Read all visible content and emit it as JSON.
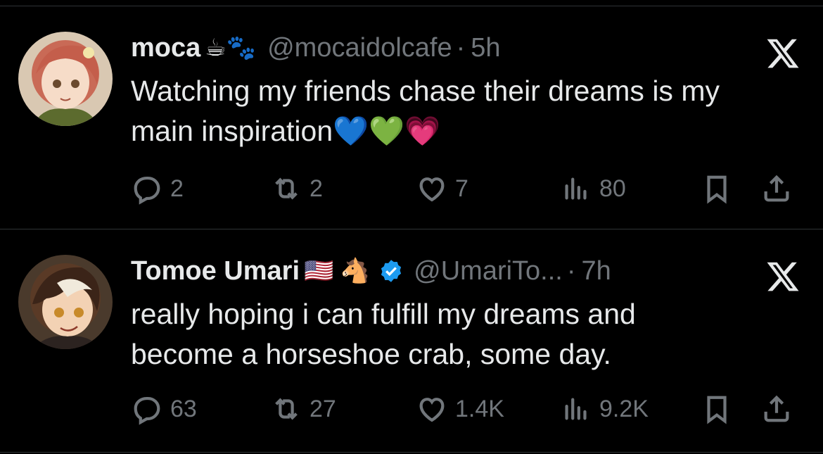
{
  "tweets": [
    {
      "name": "moca",
      "name_emoji": "☕🐾",
      "handle": "@mocaidolcafe",
      "separator": "·",
      "time": "5h",
      "text_line1": "Watching my friends chase their dreams is my",
      "text_line2": "main inspiration💙💚💗",
      "replies": "2",
      "reposts": "2",
      "likes": "7",
      "views": "80"
    },
    {
      "name": "Tomoe Umari",
      "name_emoji": "🇺🇸 🐴",
      "handle": "@UmariTo...",
      "separator": "·",
      "time": "7h",
      "text_line1": "really hoping i can fulfill my dreams and",
      "text_line2": "become a horseshoe crab, some day.",
      "replies": "63",
      "reposts": "27",
      "likes": "1.4K",
      "views": "9.2K"
    }
  ],
  "icons": {
    "reply": "reply-icon",
    "repost": "repost-icon",
    "like": "heart-icon",
    "views": "views-icon",
    "bookmark": "bookmark-icon",
    "share": "share-icon",
    "brand": "x-logo-icon",
    "verified": "verified-badge-icon"
  },
  "colors": {
    "background": "#000000",
    "text": "#e7e9ea",
    "muted": "#71767b",
    "divider": "#2f3336",
    "verified": "#1d9bf0"
  }
}
